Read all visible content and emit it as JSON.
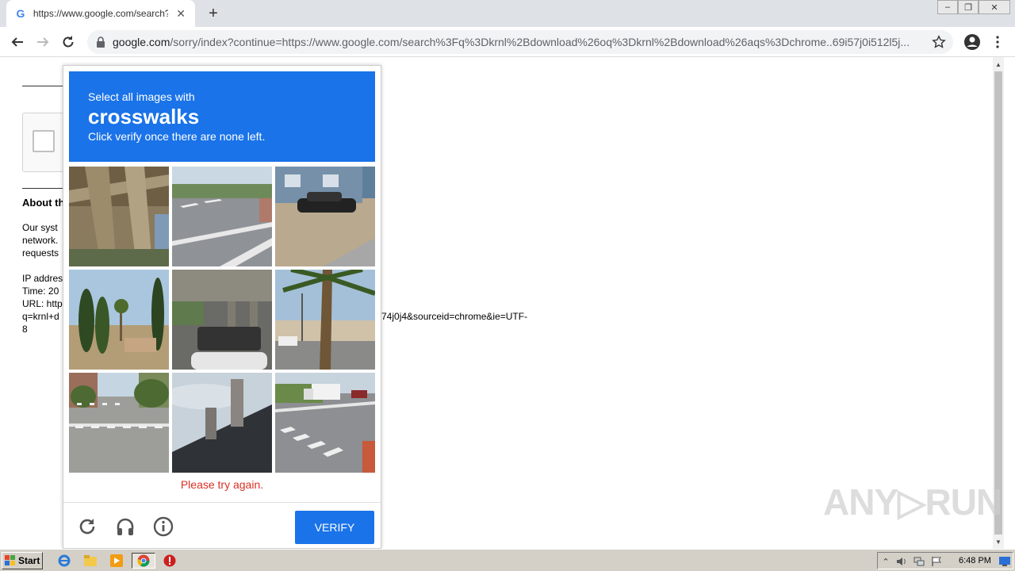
{
  "browser": {
    "tab_title": "https://www.google.com/search?q=",
    "url_host": "google.com",
    "url_rest": "/sorry/index?continue=https://www.google.com/search%3Fq%3Dkrnl%2Bdownload%26oq%3Dkrnl%2Bdownload%26aqs%3Dchrome..69i57j0i512l5j..."
  },
  "window_controls": [
    "–",
    "❐",
    "✕"
  ],
  "page": {
    "about_heading": "About th",
    "para_lines": [
      "Our syst",
      "network.",
      "requests"
    ],
    "info_lines": [
      "IP addres",
      "Time: 20",
      "URL: http",
      "q=krnl+d",
      "8"
    ],
    "url_tail": "74j0j4&sourceid=chrome&ie=UTF-"
  },
  "captcha": {
    "instruction": "Select all images with",
    "keyword": "crosswalks",
    "subtext": "Click verify once there are none left.",
    "error": "Please try again.",
    "verify_label": "VERIFY",
    "tiles": [
      "underpass-beams",
      "street-crosswalk",
      "parked-car-house",
      "cypress-trees",
      "trucks-under-overpass",
      "palm-tree-building",
      "city-street-crosswalk",
      "roof-chimney",
      "truck-crosswalk"
    ]
  },
  "watermark": "ANY▷RUN",
  "taskbar": {
    "start_label": "Start",
    "clock": "6:48 PM"
  },
  "colors": {
    "accent": "#1a73e8",
    "error": "#d93025"
  }
}
